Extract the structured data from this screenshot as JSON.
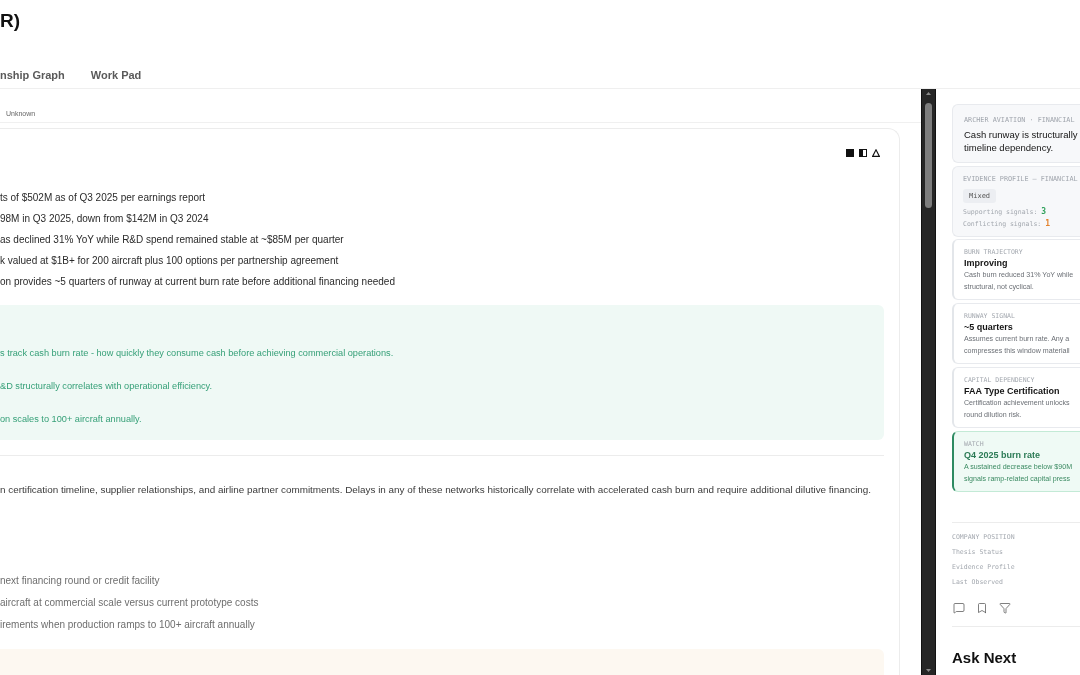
{
  "header": {
    "title": "R)",
    "tabs": [
      {
        "label": "nship Graph",
        "selected": false
      },
      {
        "label": "Work Pad",
        "selected": false
      }
    ]
  },
  "meta": {
    "status": "Unknown"
  },
  "analysis": {
    "facts": [
      "ts of $502M as of Q3 2025 per earnings report",
      "98M in Q3 2025, down from $142M in Q3 2024",
      "as declined 31% YoY while R&D spend remained stable at ~$85M per quarter",
      "k valued at $1B+ for 200 aircraft plus 100 options per partnership agreement",
      "on provides ~5 quarters of runway at current burn rate before additional financing needed"
    ],
    "insight_lines": [
      "s track cash burn rate - how quickly they consume cash before achieving commercial operations.",
      "&D structurally correlates with operational efficiency.",
      "on scales to 100+ aircraft annually."
    ],
    "paragraph": "n certification timeline, supplier relationships, and airline partner commitments. Delays in any of these networks historically correlate with accelerated cash burn and require additional dilutive financing.",
    "questions": [
      "next financing round or credit facility",
      "aircraft at commercial scale versus current prototype costs",
      "irements when production ramps to 100+ aircraft annually"
    ]
  },
  "side_panel": {
    "thesis": {
      "label": "ARCHER AVIATION · FINANCIAL",
      "lines": [
        "Cash runway is structurally",
        "timeline dependency."
      ]
    },
    "evidence": {
      "label": "EVIDENCE PROFILE — FINANCIAL",
      "badge": "Mixed",
      "signals": [
        {
          "label": "Supporting signals:",
          "count": "3",
          "color": "#2ea05a"
        },
        {
          "label": "Conflicting signals:",
          "count": "1",
          "color": "#e3822c"
        }
      ]
    },
    "signal_cards": [
      {
        "kind": "standard",
        "label": "BURN TRAJECTORY",
        "title": "Improving",
        "lines": [
          "Cash burn reduced 31% YoY while",
          "structural, not cyclical."
        ]
      },
      {
        "kind": "standard",
        "label": "RUNWAY SIGNAL",
        "title": "~5 quarters",
        "lines": [
          "Assumes current burn rate. Any a",
          "compresses this window materiall"
        ]
      },
      {
        "kind": "standard",
        "label": "CAPITAL DEPENDENCY",
        "title": "FAA Type Certification",
        "lines": [
          "Certification achievement unlocks",
          "round dilution risk."
        ]
      },
      {
        "kind": "watch",
        "label": "WATCH",
        "title": "Q4 2025 burn rate",
        "lines": [
          "A sustained decrease below $90M",
          "signals ramp-related capital press"
        ]
      }
    ],
    "company_position": {
      "label": "COMPANY POSITION",
      "rows": [
        "Thesis Status",
        "Evidence Profile",
        "Last Observed"
      ]
    },
    "ask_next": {
      "title": "Ask Next"
    }
  }
}
